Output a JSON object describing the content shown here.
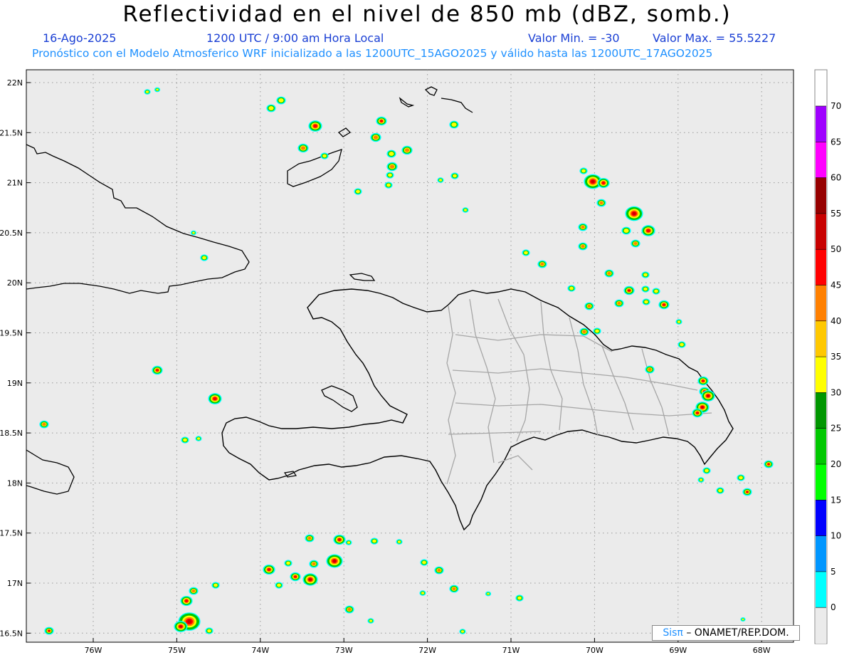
{
  "header": {
    "title": "Reflectividad en el nivel de 850 mb (dBZ, somb.)",
    "date": "16-Ago-2025",
    "time": "1200 UTC / 9:00 am Hora Local",
    "val_min": "Valor Min. = -30",
    "val_max": "Valor Max. = 55.5227",
    "forecast": "Pronóstico con el Modelo Atmosferico WRF inicializado a las 1200UTC_15AGO2025 y válido hasta las 1200UTC_17AGO2025"
  },
  "axes": {
    "lat_labels": [
      "22N",
      "21.5N",
      "21N",
      "20.5N",
      "20N",
      "19.5N",
      "19N",
      "18.5N",
      "18N",
      "17.5N",
      "17N",
      "16.5N"
    ],
    "lon_labels": [
      "76W",
      "75W",
      "74W",
      "73W",
      "72W",
      "71W",
      "70W",
      "69W",
      "68W"
    ]
  },
  "colorbar": {
    "ticks": [
      "70",
      "65",
      "60",
      "55",
      "50",
      "45",
      "40",
      "35",
      "30",
      "25",
      "20",
      "15",
      "10",
      "5",
      "0"
    ],
    "colors": [
      "#9f00ff",
      "#ff00ff",
      "#960000",
      "#c80000",
      "#ff0000",
      "#ff8000",
      "#ffc800",
      "#ffff00",
      "#009600",
      "#00c800",
      "#00ff00",
      "#0000ff",
      "#0096ff",
      "#00ffff"
    ]
  },
  "credit": {
    "sis": "Sisπ",
    "rest": "– ONAMET/REP.DOM."
  }
}
